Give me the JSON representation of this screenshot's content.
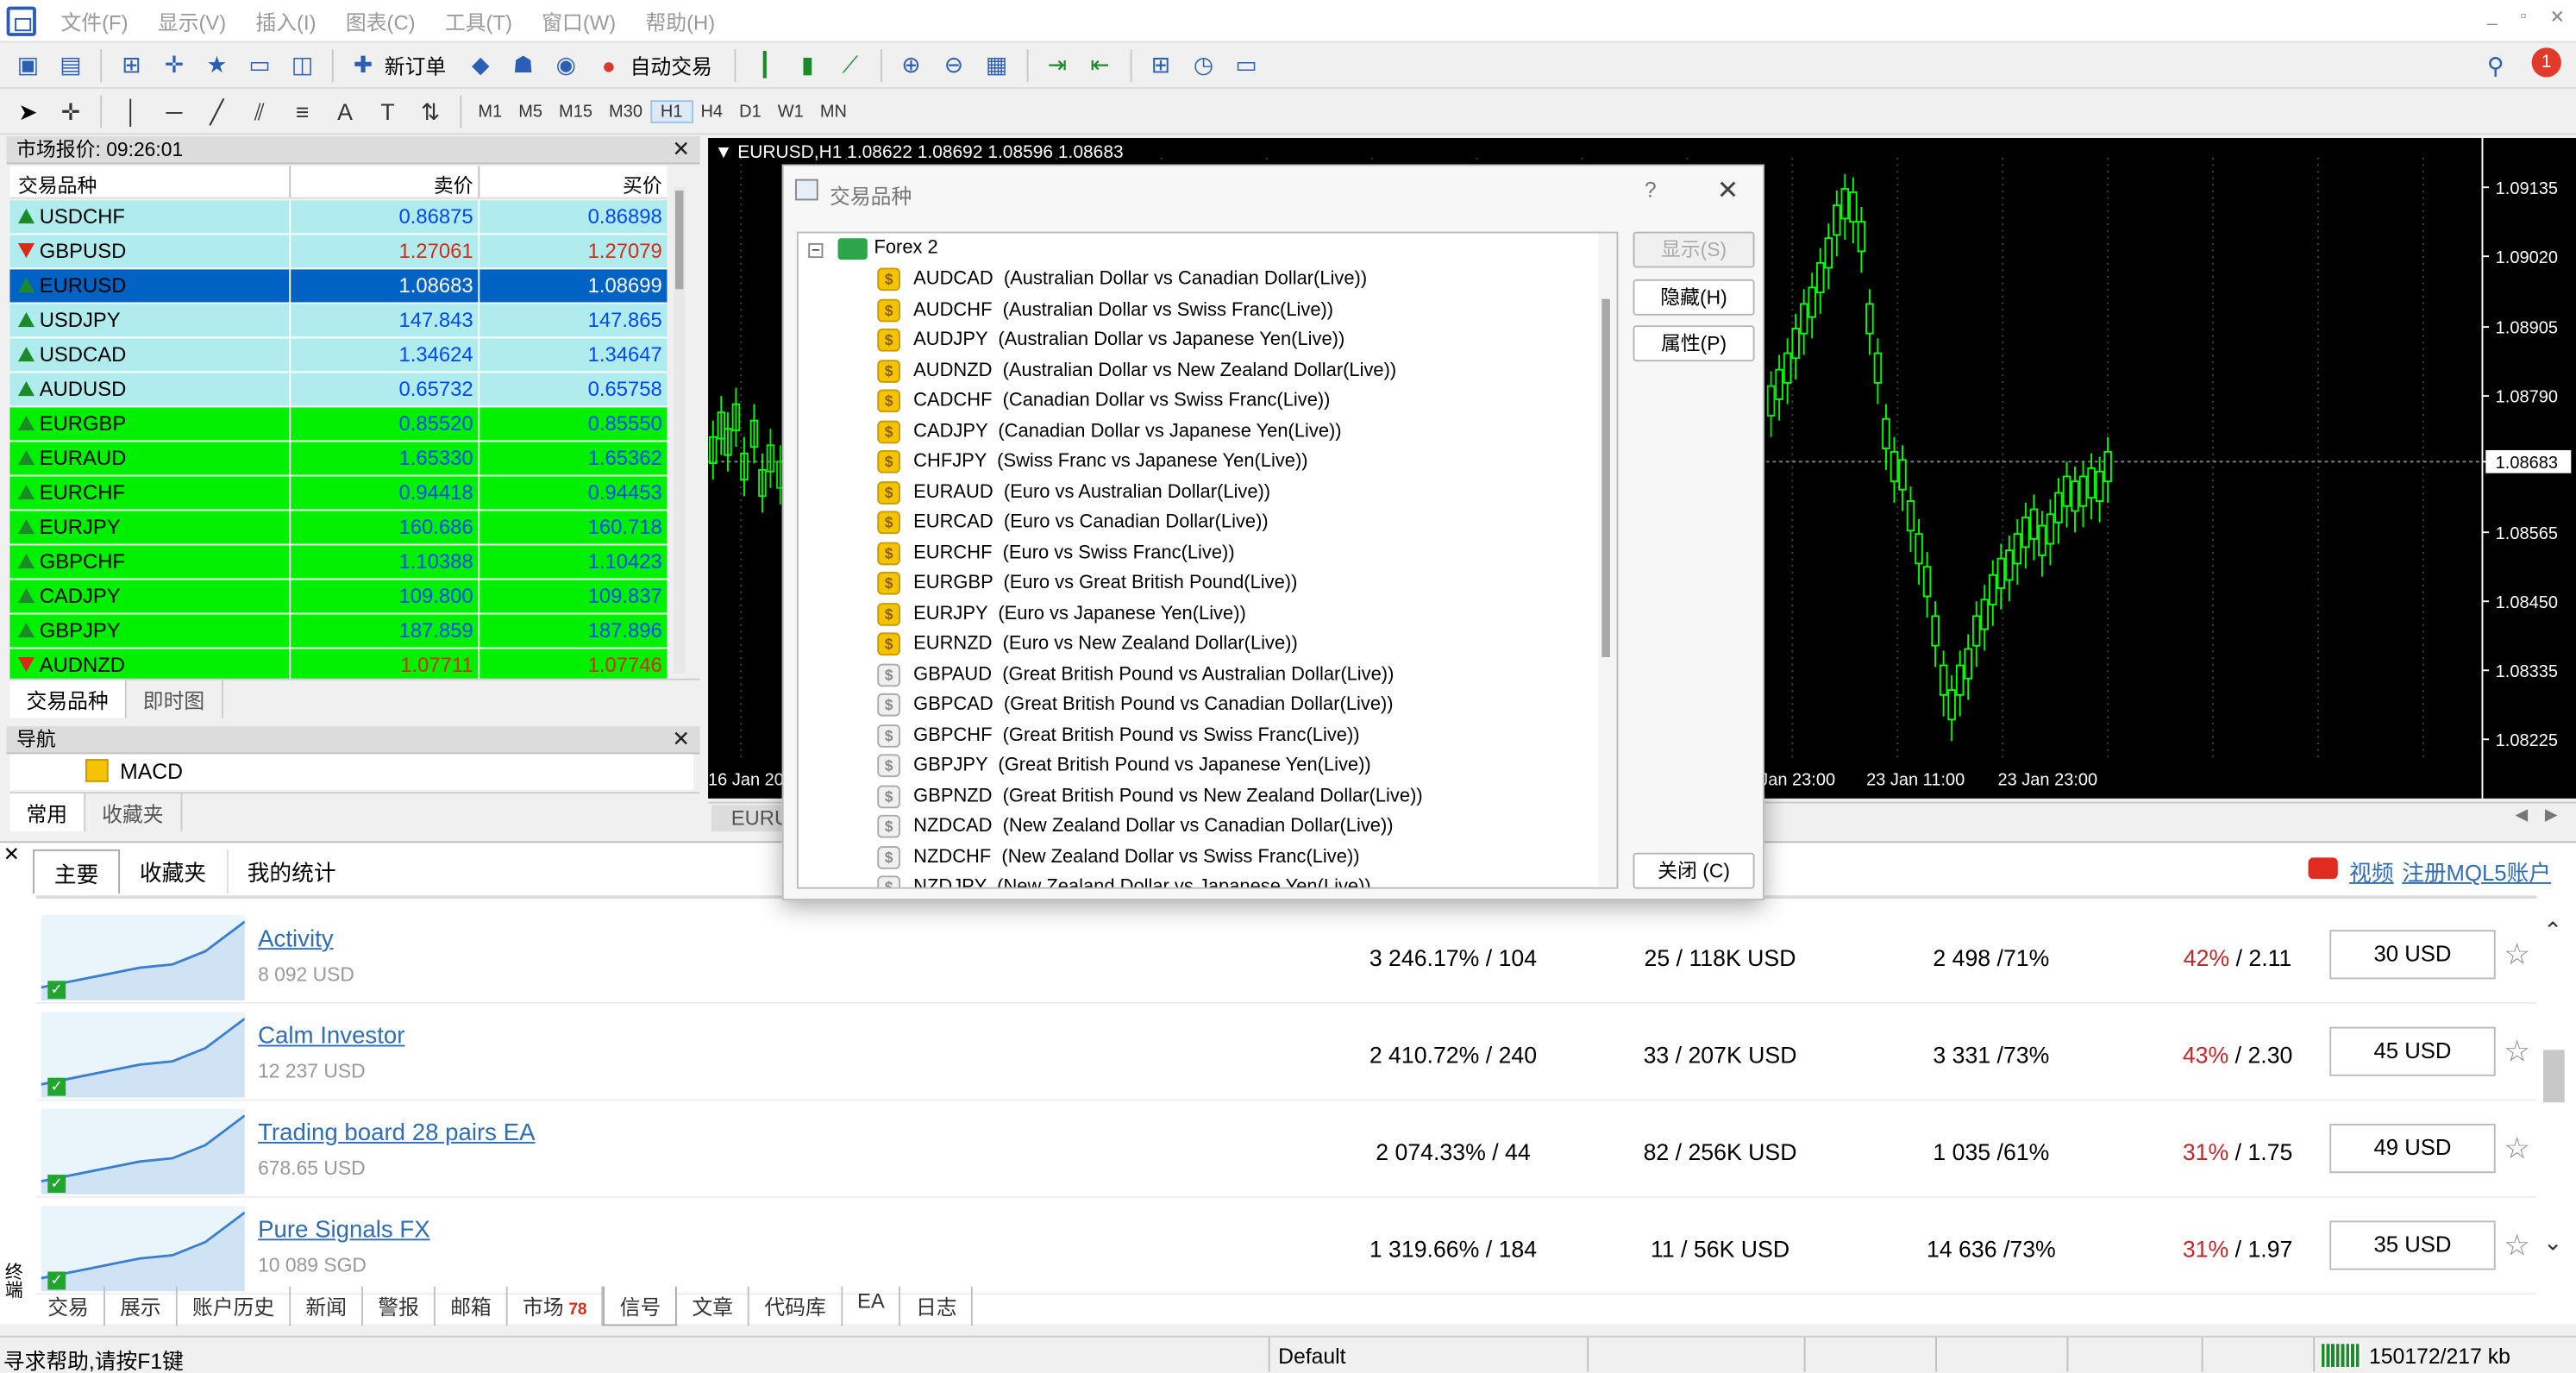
{
  "menu": [
    "文件(F)",
    "显示(V)",
    "插入(I)",
    "图表(C)",
    "工具(T)",
    "窗口(W)",
    "帮助(H)"
  ],
  "notification_count": "1",
  "toolbar": {
    "new_order": "新订单",
    "auto_trade": "自动交易"
  },
  "timeframes": [
    "M1",
    "M5",
    "M15",
    "M30",
    "H1",
    "H4",
    "D1",
    "W1",
    "MN"
  ],
  "market_watch": {
    "title": "市场报价: 09:26:01",
    "col_symbol": "交易品种",
    "col_bid": "卖价",
    "col_ask": "买价",
    "rows": [
      {
        "symbol": "USDCHF",
        "bid": "0.86875",
        "ask": "0.86898"
      },
      {
        "symbol": "GBPUSD",
        "bid": "1.27061",
        "ask": "1.27079"
      },
      {
        "symbol": "EURUSD",
        "bid": "1.08683",
        "ask": "1.08699"
      },
      {
        "symbol": "USDJPY",
        "bid": "147.843",
        "ask": "147.865"
      },
      {
        "symbol": "USDCAD",
        "bid": "1.34624",
        "ask": "1.34647"
      },
      {
        "symbol": "AUDUSD",
        "bid": "0.65732",
        "ask": "0.65758"
      },
      {
        "symbol": "EURGBP",
        "bid": "0.85520",
        "ask": "0.85550"
      },
      {
        "symbol": "EURAUD",
        "bid": "1.65330",
        "ask": "1.65362"
      },
      {
        "symbol": "EURCHF",
        "bid": "0.94418",
        "ask": "0.94453"
      },
      {
        "symbol": "EURJPY",
        "bid": "160.686",
        "ask": "160.718"
      },
      {
        "symbol": "GBPCHF",
        "bid": "1.10388",
        "ask": "1.10423"
      },
      {
        "symbol": "CADJPY",
        "bid": "109.800",
        "ask": "109.837"
      },
      {
        "symbol": "GBPJPY",
        "bid": "187.859",
        "ask": "187.896"
      },
      {
        "symbol": "AUDNZD",
        "bid": "1.07711",
        "ask": "1.07746"
      }
    ],
    "tabs": [
      "交易品种",
      "即时图"
    ]
  },
  "navigator": {
    "title": "导航",
    "item": "MACD",
    "tabs": [
      "常用",
      "收藏夹"
    ]
  },
  "chart": {
    "title": "EURUSD,H1  1.08622 1.08692 1.08596 1.08683",
    "prices": [
      "1.09135",
      "1.09020",
      "1.08905",
      "1.08790",
      "1.08683",
      "1.08565",
      "1.08450",
      "1.08335",
      "1.08225"
    ],
    "times": [
      "16 Jan 20",
      "Jan 23:00",
      "23 Jan 11:00",
      "23 Jan 23:00"
    ],
    "tab": "EURU",
    "colors": {
      "bg": "#000000",
      "candle": "#00ff00"
    }
  },
  "dialog": {
    "title": "交易品种",
    "help": "?",
    "group": "Forex 2",
    "items": [
      "AUDCAD  (Australian Dollar vs Canadian Dollar(Live))",
      "AUDCHF  (Australian Dollar vs Swiss Franc(Live))",
      "AUDJPY  (Australian Dollar vs Japanese Yen(Live))",
      "AUDNZD  (Australian Dollar vs New Zealand Dollar(Live))",
      "CADCHF  (Canadian Dollar vs Swiss Franc(Live))",
      "CADJPY  (Canadian Dollar vs Japanese Yen(Live))",
      "CHFJPY  (Swiss Franc vs Japanese Yen(Live))",
      "EURAUD  (Euro vs Australian Dollar(Live))",
      "EURCAD  (Euro vs Canadian Dollar(Live))",
      "EURCHF  (Euro vs Swiss Franc(Live))",
      "EURGBP  (Euro vs Great British Pound(Live))",
      "EURJPY  (Euro vs Japanese Yen(Live))",
      "EURNZD  (Euro vs New Zealand Dollar(Live))",
      "GBPAUD  (Great British Pound vs Australian Dollar(Live))",
      "GBPCAD  (Great British Pound vs Canadian Dollar(Live))",
      "GBPCHF  (Great British Pound vs Swiss Franc(Live))",
      "GBPJPY  (Great British Pound vs Japanese Yen(Live))",
      "GBPNZD  (Great British Pound vs New Zealand Dollar(Live))",
      "NZDCAD  (New Zealand Dollar vs Canadian Dollar(Live))",
      "NZDCHF  (New Zealand Dollar vs Swiss Franc(Live))",
      "NZDJPY  (New Zealand Dollar vs Japanese Yen(Live))"
    ],
    "btn_show": "显示(S)",
    "btn_hide": "隐藏(H)",
    "btn_props": "属性(P)",
    "btn_close": "关闭 (C)"
  },
  "terminal": {
    "tabs_top": [
      "主要",
      "收藏夹",
      "我的统计"
    ],
    "video": "视频",
    "register": "注册MQL5账户",
    "signals": [
      {
        "name": "Activity",
        "price": "8 092 USD",
        "growth": "3 246.17% / 104",
        "subs": "25 / 118K USD",
        "trades": "2 498 /71%",
        "dd_red": "42%",
        "dd_rest": " / 2.11",
        "btn": "30 USD"
      },
      {
        "name": "Calm Investor",
        "price": "12 237 USD",
        "growth": "2 410.72% / 240",
        "subs": "33 / 207K USD",
        "trades": "3 331 /73%",
        "dd_red": "43%",
        "dd_rest": " / 2.30",
        "btn": "45 USD"
      },
      {
        "name": "Trading board 28 pairs EA",
        "price": "678.65 USD",
        "growth": "2 074.33% / 44",
        "subs": "82 / 256K USD",
        "trades": "1 035 /61%",
        "dd_red": "31%",
        "dd_rest": " / 1.75",
        "btn": "49 USD"
      },
      {
        "name": "Pure Signals FX",
        "price": "10 089 SGD",
        "growth": "1 319.66% / 184",
        "subs": "11 / 56K USD",
        "trades": "14 636 /73%",
        "dd_red": "31%",
        "dd_rest": " / 1.97",
        "btn": "35 USD"
      }
    ],
    "side_label": "终端",
    "tabs_bottom": [
      "交易",
      "展示",
      "账户历史",
      "新闻",
      "警报",
      "邮箱",
      "市场",
      "信号",
      "文章",
      "代码库",
      "EA",
      "日志"
    ],
    "market_badge": "78"
  },
  "status": {
    "help": "寻求帮助,请按F1键",
    "profile": "Default",
    "traffic": "150172/217 kb"
  }
}
